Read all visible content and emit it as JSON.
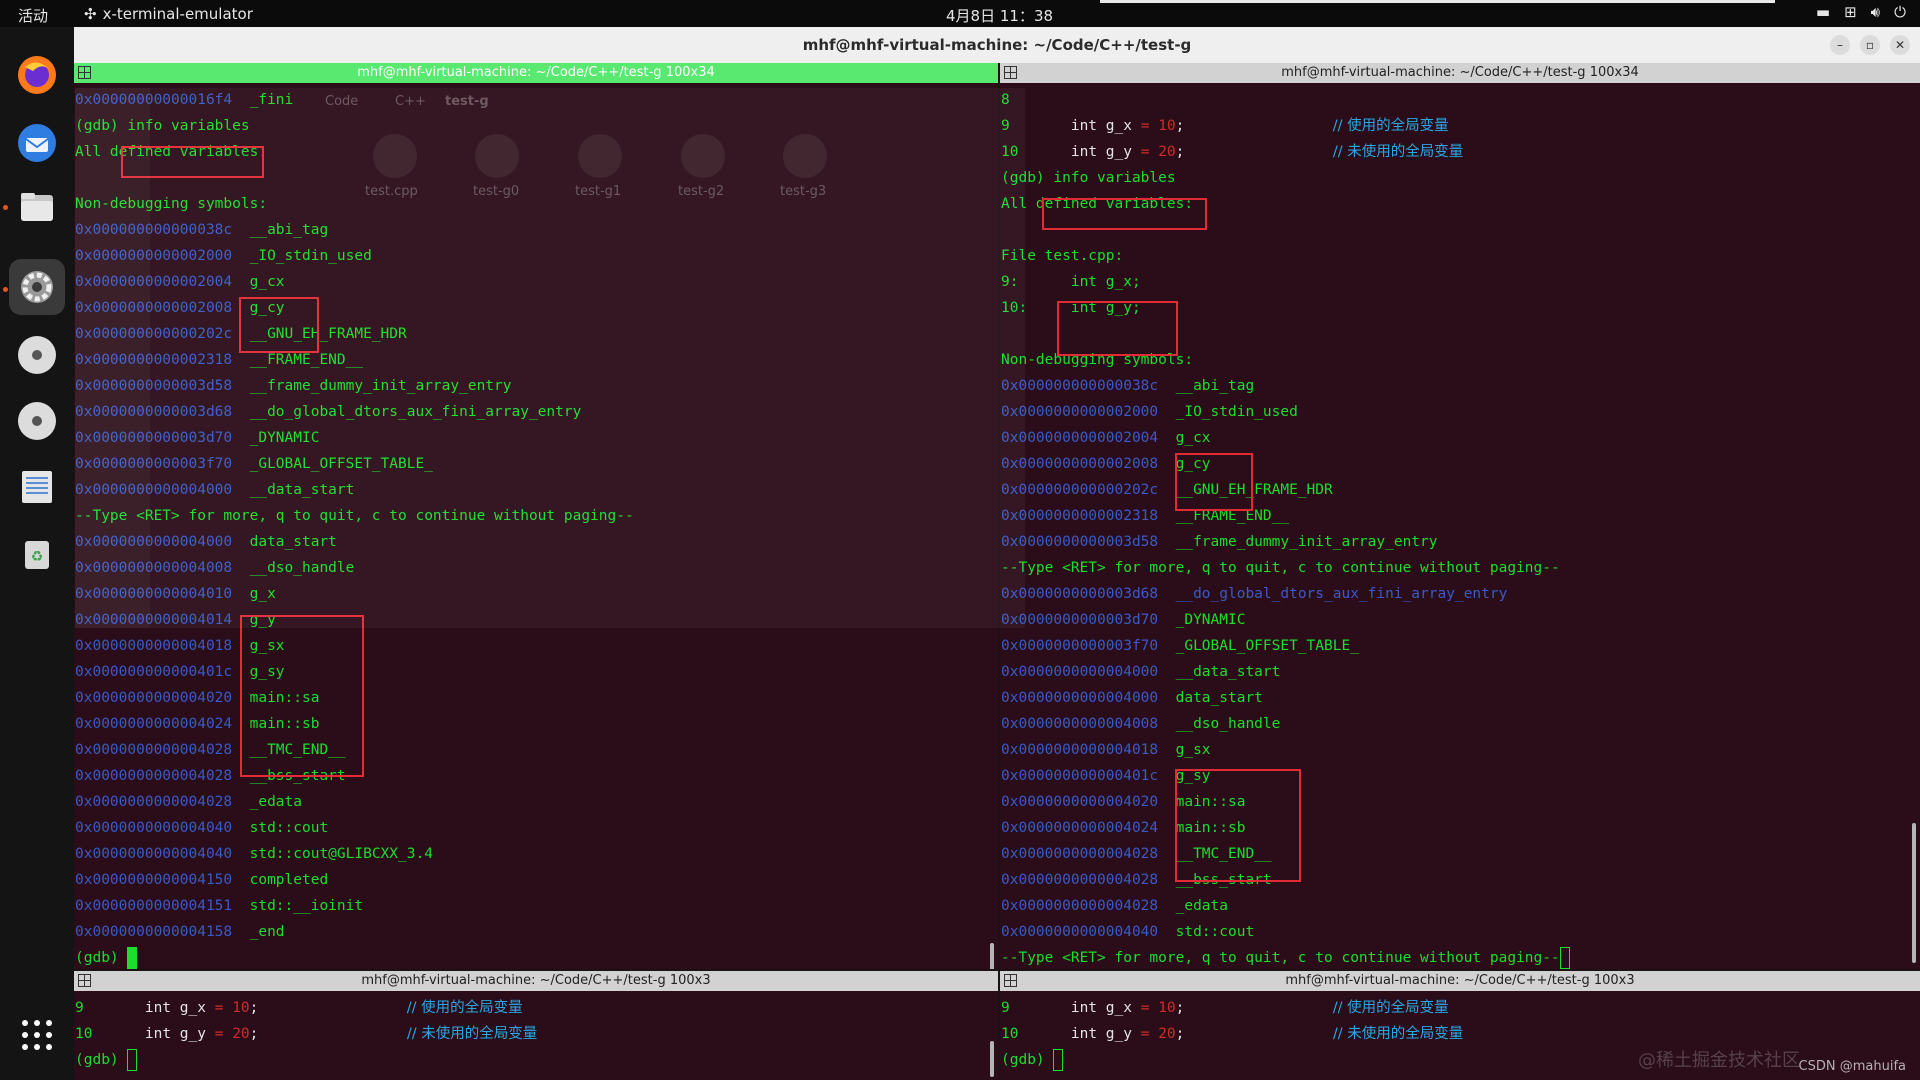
{
  "topbar": {
    "activities": "活动",
    "app_name": "x-terminal-emulator",
    "clock": "4月8日  11：38"
  },
  "window": {
    "title": "mhf@mhf-virtual-machine: ~/Code/C++/test-g"
  },
  "ghost_filemanager": {
    "path": [
      "Code",
      "C++",
      "test-g"
    ],
    "files": [
      "test.cpp",
      "test-g0",
      "test-g1",
      "test-g2",
      "test-g3"
    ]
  },
  "panes": {
    "top_left": {
      "title": "mhf@mhf-virtual-machine: ~/Code/C++/test-g 100x34",
      "lines": [
        {
          "addr": "0x00000000000016f4",
          "sym": "_fini"
        },
        {
          "text": "(gdb) info variables"
        },
        {
          "text": "All defined variables:"
        },
        {
          "text": ""
        },
        {
          "text": "Non-debugging symbols:"
        },
        {
          "addr": "0x000000000000038c",
          "sym": "__abi_tag"
        },
        {
          "addr": "0x0000000000002000",
          "sym": "_IO_stdin_used"
        },
        {
          "addr": "0x0000000000002004",
          "sym": "g_cx"
        },
        {
          "addr": "0x0000000000002008",
          "sym": "g_cy"
        },
        {
          "addr": "0x000000000000202c",
          "sym": "__GNU_EH_FRAME_HDR"
        },
        {
          "addr": "0x0000000000002318",
          "sym": "__FRAME_END__"
        },
        {
          "addr": "0x0000000000003d58",
          "sym": "__frame_dummy_init_array_entry"
        },
        {
          "addr": "0x0000000000003d68",
          "sym": "__do_global_dtors_aux_fini_array_entry"
        },
        {
          "addr": "0x0000000000003d70",
          "sym": "_DYNAMIC"
        },
        {
          "addr": "0x0000000000003f70",
          "sym": "_GLOBAL_OFFSET_TABLE_"
        },
        {
          "addr": "0x0000000000004000",
          "sym": "__data_start"
        },
        {
          "text": "--Type <RET> for more, q to quit, c to continue without paging--"
        },
        {
          "addr": "0x0000000000004000",
          "sym": "data_start"
        },
        {
          "addr": "0x0000000000004008",
          "sym": "__dso_handle"
        },
        {
          "addr": "0x0000000000004010",
          "sym": "g_x"
        },
        {
          "addr": "0x0000000000004014",
          "sym": "g_y"
        },
        {
          "addr": "0x0000000000004018",
          "sym": "g_sx"
        },
        {
          "addr": "0x000000000000401c",
          "sym": "g_sy"
        },
        {
          "addr": "0x0000000000004020",
          "sym": "main::sa"
        },
        {
          "addr": "0x0000000000004024",
          "sym": "main::sb"
        },
        {
          "addr": "0x0000000000004028",
          "sym": "__TMC_END__"
        },
        {
          "addr": "0x0000000000004028",
          "sym": "__bss_start"
        },
        {
          "addr": "0x0000000000004028",
          "sym": "_edata"
        },
        {
          "addr": "0x0000000000004040",
          "sym": "std::cout"
        },
        {
          "addr": "0x0000000000004040",
          "sym": "std::cout@GLIBCXX_3.4"
        },
        {
          "addr": "0x0000000000004150",
          "sym": "completed"
        },
        {
          "addr": "0x0000000000004151",
          "sym": "std::__ioinit"
        },
        {
          "addr": "0x0000000000004158",
          "sym": "_end"
        },
        {
          "text": "(gdb) ",
          "cursor": "solid"
        }
      ]
    },
    "top_right": {
      "title": "mhf@mhf-virtual-machine: ~/Code/C++/test-g 100x34",
      "lines": [
        {
          "text": "8"
        },
        {
          "code": {
            "num": "9",
            "type": "int",
            "name": "g_x",
            "val": "10",
            "comment": "// 使用的全局变量"
          }
        },
        {
          "code": {
            "num": "10",
            "type": "int",
            "name": "g_y",
            "val": "20",
            "comment": "// 未使用的全局变量"
          }
        },
        {
          "text": "(gdb) info variables"
        },
        {
          "text": "All defined variables:"
        },
        {
          "text": ""
        },
        {
          "text": "File test.cpp:"
        },
        {
          "text": "9:      int g_x;"
        },
        {
          "text": "10:     int g_y;"
        },
        {
          "text": ""
        },
        {
          "text": "Non-debugging symbols:"
        },
        {
          "addr": "0x000000000000038c",
          "sym": "__abi_tag"
        },
        {
          "addr": "0x0000000000002000",
          "sym": "_IO_stdin_used"
        },
        {
          "addr": "0x0000000000002004",
          "sym": "g_cx"
        },
        {
          "addr": "0x0000000000002008",
          "sym": "g_cy"
        },
        {
          "addr": "0x000000000000202c",
          "sym": "__GNU_EH_FRAME_HDR"
        },
        {
          "addr": "0x0000000000002318",
          "sym": "__FRAME_END__"
        },
        {
          "addr": "0x0000000000003d58",
          "sym": "__frame_dummy_init_array_entry"
        },
        {
          "text": "--Type <RET> for more, q to quit, c to continue without paging--"
        },
        {
          "addr": "0x0000000000003d68",
          "sym": "__do_global_dtors_aux_fini_array_entry",
          "dim": true
        },
        {
          "addr": "0x0000000000003d70",
          "sym": "_DYNAMIC"
        },
        {
          "addr": "0x0000000000003f70",
          "sym": "_GLOBAL_OFFSET_TABLE_"
        },
        {
          "addr": "0x0000000000004000",
          "sym": "__data_start"
        },
        {
          "addr": "0x0000000000004000",
          "sym": "data_start"
        },
        {
          "addr": "0x0000000000004008",
          "sym": "__dso_handle"
        },
        {
          "addr": "0x0000000000004018",
          "sym": "g_sx"
        },
        {
          "addr": "0x000000000000401c",
          "sym": "g_sy"
        },
        {
          "addr": "0x0000000000004020",
          "sym": "main::sa"
        },
        {
          "addr": "0x0000000000004024",
          "sym": "main::sb"
        },
        {
          "addr": "0x0000000000004028",
          "sym": "__TMC_END__"
        },
        {
          "addr": "0x0000000000004028",
          "sym": "__bss_start"
        },
        {
          "addr": "0x0000000000004028",
          "sym": "_edata"
        },
        {
          "addr": "0x0000000000004040",
          "sym": "std::cout"
        },
        {
          "text": "--Type <RET> for more, q to quit, c to continue without paging--",
          "cursor": "hollow"
        }
      ]
    },
    "bottom_left": {
      "title": "mhf@mhf-virtual-machine: ~/Code/C++/test-g 100x3",
      "lines": [
        {
          "code": {
            "num": "9",
            "type": "int",
            "name": "g_x",
            "val": "10",
            "comment": "// 使用的全局变量"
          }
        },
        {
          "code": {
            "num": "10",
            "type": "int",
            "name": "g_y",
            "val": "20",
            "comment": "// 未使用的全局变量"
          }
        },
        {
          "text": "(gdb) ",
          "cursor": "hollow"
        }
      ]
    },
    "bottom_right": {
      "title": "mhf@mhf-virtual-machine: ~/Code/C++/test-g 100x3",
      "lines": [
        {
          "code": {
            "num": "9",
            "type": "int",
            "name": "g_x",
            "val": "10",
            "comment": "// 使用的全局变量"
          }
        },
        {
          "code": {
            "num": "10",
            "type": "int",
            "name": "g_y",
            "val": "20",
            "comment": "// 未使用的全局变量"
          }
        },
        {
          "text": "(gdb) ",
          "cursor": "hollow"
        }
      ]
    }
  },
  "watermark": {
    "cn": "@稀土掘金技术社区",
    "en": "CSDN @mahuifa"
  },
  "colors": {
    "terminal_bg": "#2b0d19",
    "text_green": "#1cde2c",
    "addr_blue": "#3a5ac8",
    "highlight_red": "#e32b35",
    "focused_title": "#59e870"
  }
}
